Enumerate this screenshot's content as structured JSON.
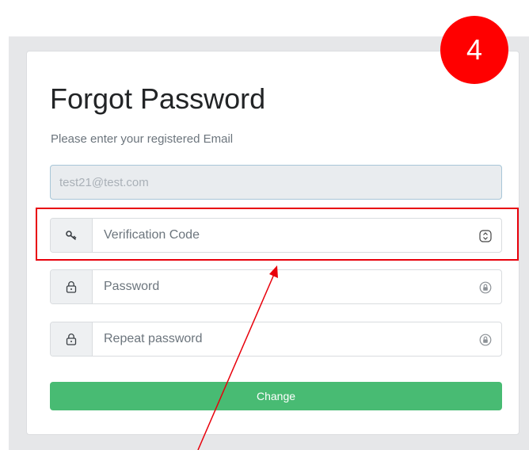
{
  "form": {
    "title": "Forgot Password",
    "subtitle": "Please enter your registered Email",
    "email_value": "test21@test.com",
    "verification_placeholder": "Verification Code",
    "password_placeholder": "Password",
    "repeat_password_placeholder": "Repeat password",
    "change_label": "Change"
  },
  "annotation": {
    "step_number": "4",
    "highlight_color": "#e8000b",
    "badge_color": "#ff0000"
  },
  "colors": {
    "button": "#48bb73",
    "addon_background": "#eef0f2"
  },
  "icons": {
    "verification": "key-icon",
    "password": "lock-icon",
    "repeat_password": "lock-icon",
    "verification_trailing": "stepper-icon",
    "password_trailing": "password-manager-icon"
  }
}
